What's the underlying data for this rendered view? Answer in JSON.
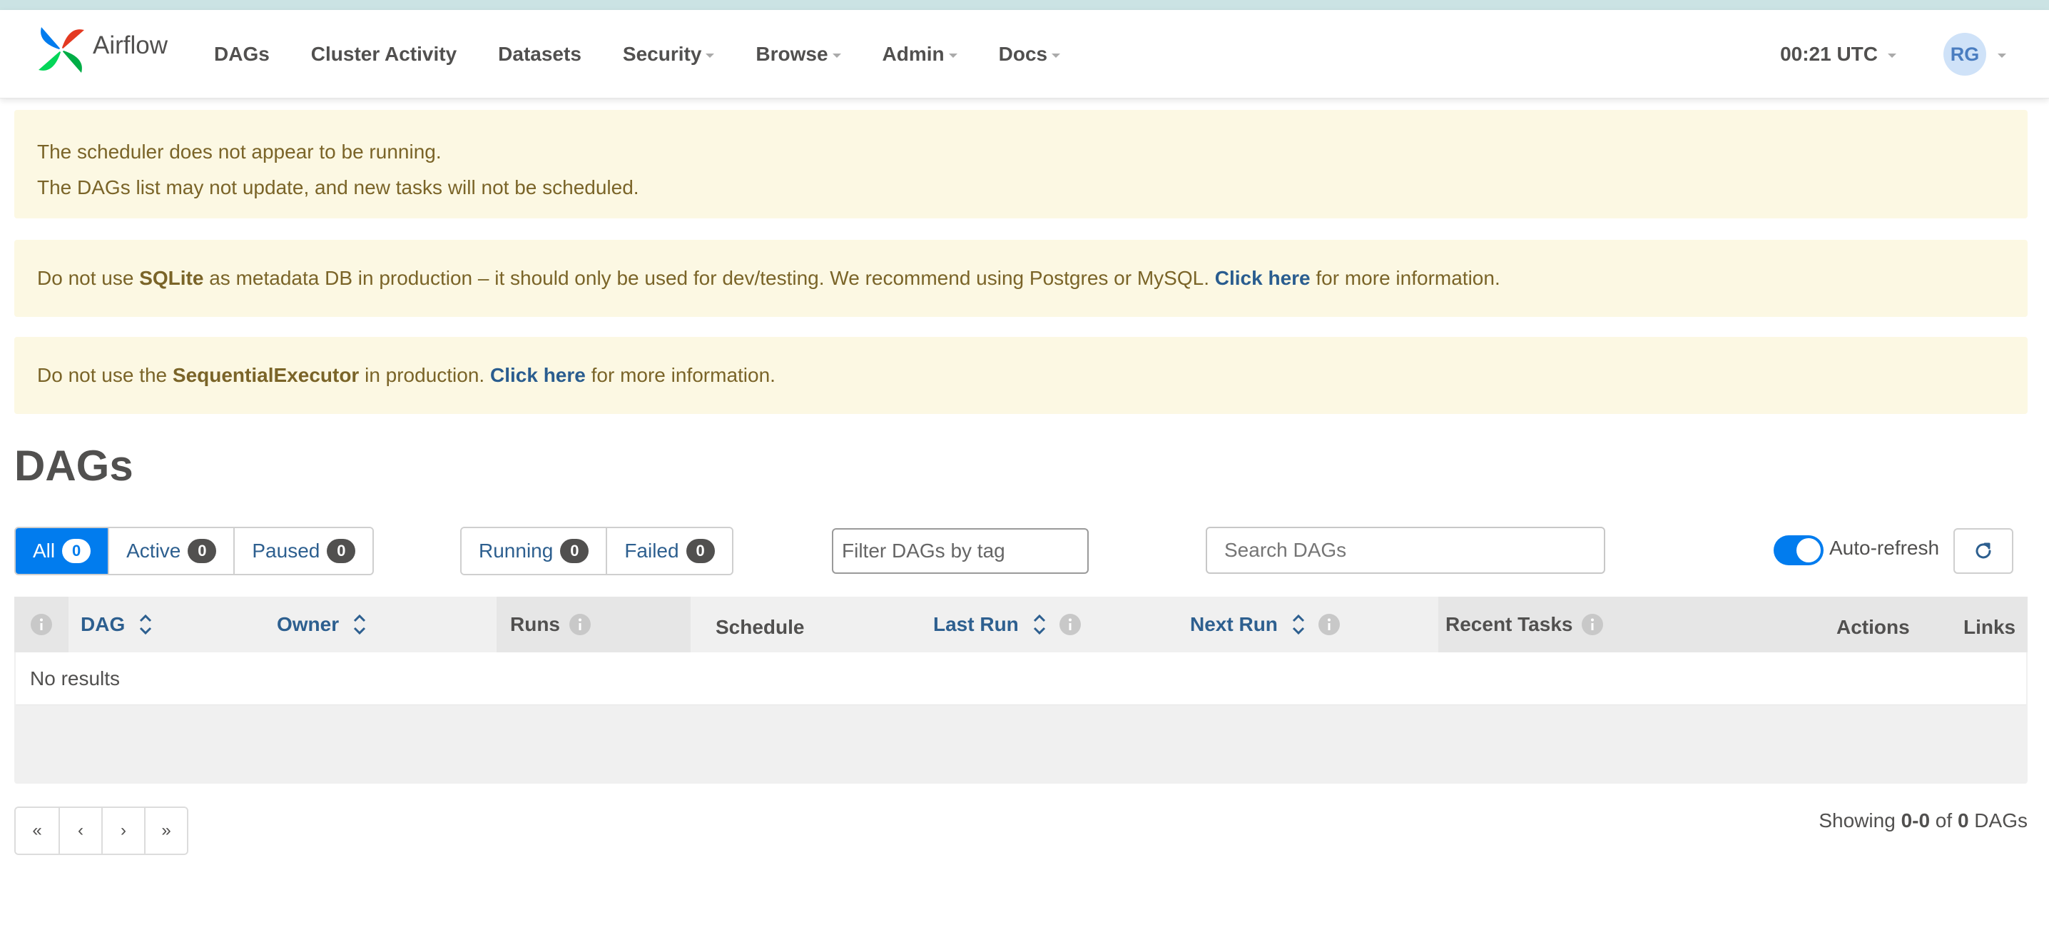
{
  "brand": {
    "name": "Airflow"
  },
  "nav": {
    "items": [
      {
        "label": "DAGs",
        "dropdown": false
      },
      {
        "label": "Cluster Activity",
        "dropdown": false
      },
      {
        "label": "Datasets",
        "dropdown": false
      },
      {
        "label": "Security",
        "dropdown": true
      },
      {
        "label": "Browse",
        "dropdown": true
      },
      {
        "label": "Admin",
        "dropdown": true
      },
      {
        "label": "Docs",
        "dropdown": true
      }
    ],
    "clock": "00:21 UTC",
    "user_initials": "RG"
  },
  "alerts": {
    "scheduler_line1": "The scheduler does not appear to be running.",
    "scheduler_line2": "The DAGs list may not update, and new tasks will not be scheduled.",
    "sqlite_pre": "Do not use ",
    "sqlite_bold": "SQLite",
    "sqlite_mid": " as metadata DB in production – it should only be used for dev/testing. We recommend using Postgres or MySQL. ",
    "sqlite_link": "Click here",
    "sqlite_post": " for more information.",
    "executor_pre": "Do not use the ",
    "executor_bold": "SequentialExecutor",
    "executor_mid": " in production. ",
    "executor_link": "Click here",
    "executor_post": " for more information."
  },
  "page_title": "DAGs",
  "status_filters": [
    {
      "label": "All",
      "count": "0",
      "active": true
    },
    {
      "label": "Active",
      "count": "0",
      "active": false
    },
    {
      "label": "Paused",
      "count": "0",
      "active": false
    }
  ],
  "run_filters": [
    {
      "label": "Running",
      "count": "0"
    },
    {
      "label": "Failed",
      "count": "0"
    }
  ],
  "tag_filter_placeholder": "Filter DAGs by tag",
  "search_placeholder": "Search DAGs",
  "auto_refresh": {
    "label": "Auto-refresh",
    "on": true
  },
  "table": {
    "columns": {
      "dag": "DAG",
      "owner": "Owner",
      "runs": "Runs",
      "schedule": "Schedule",
      "last_run": "Last Run",
      "next_run": "Next Run",
      "recent_tasks": "Recent Tasks",
      "actions": "Actions",
      "links": "Links"
    },
    "empty_text": "No results"
  },
  "pagination": {
    "first": "«",
    "prev": "‹",
    "next": "›",
    "last": "»"
  },
  "showing": {
    "pre": "Showing ",
    "range": "0-0",
    "mid": " of ",
    "total": "0",
    "post": " DAGs"
  },
  "colors": {
    "accent": "#017cee",
    "link": "#2d5f8f",
    "alert_bg": "#fcf8e3",
    "alert_text": "#7a6428"
  }
}
